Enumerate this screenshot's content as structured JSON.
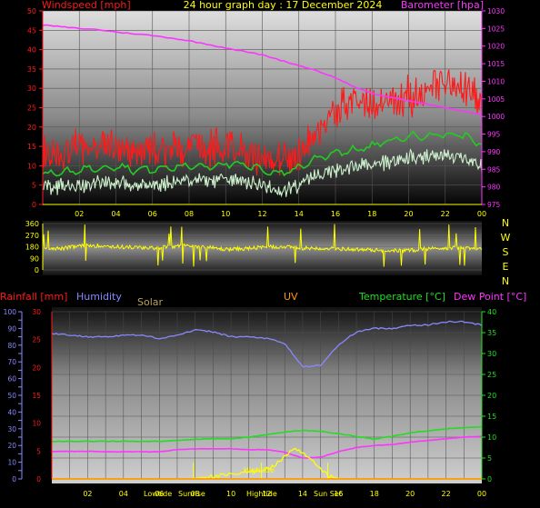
{
  "header": {
    "title": "24 hour graph day : 17 December 2024",
    "wind_label": "Windspeed [mph]",
    "baro_label": "Barometer [hpa]"
  },
  "bottom_legend": {
    "rainfall": "Rainfall [mm]",
    "humidity": "Humidity",
    "solar": "Solar",
    "uv": "UV",
    "temperature": "Temperature [°C]",
    "dewpoint": "Dew Point [°C]"
  },
  "compass": [
    "N",
    "W",
    "S",
    "E",
    "N"
  ],
  "annotations": {
    "lowtide": "Lowtide",
    "sunrise": "Sunrise",
    "hightide_top": "Hightide",
    "hightide_axis": "Hightide",
    "sunset": "Sun Set"
  },
  "colors": {
    "wind": "#ff1a1a",
    "gust_avg": "#22cc22",
    "wind_avg": "#ccf0cc",
    "barometer": "#ff33ff",
    "direction": "#ffff00",
    "humidity": "#8888ff",
    "temperature": "#22dd22",
    "dewpoint": "#ff33ff",
    "solar": "#ffff00",
    "rain": "#ff9900"
  },
  "chart_data": [
    {
      "type": "line",
      "title": "24 hour graph day : 17 December 2024",
      "x_ticks": [
        "02",
        "04",
        "06",
        "08",
        "10",
        "12",
        "14",
        "16",
        "18",
        "20",
        "22",
        "00"
      ],
      "x_range_hours": [
        0,
        24
      ],
      "y_left": {
        "label": "Windspeed [mph]",
        "ticks": [
          0,
          5,
          10,
          15,
          20,
          25,
          30,
          35,
          40,
          45,
          50
        ],
        "range": [
          0,
          50
        ]
      },
      "y_right": {
        "label": "Barometer [hpa]",
        "ticks": [
          975,
          980,
          985,
          990,
          995,
          1000,
          1005,
          1010,
          1015,
          1020,
          1025,
          1030
        ],
        "range": [
          975,
          1030
        ]
      },
      "series": [
        {
          "name": "Windspeed [mph]",
          "axis": "left",
          "x": [
            0,
            1,
            2,
            3,
            4,
            5,
            6,
            7,
            8,
            9,
            10,
            11,
            12,
            13,
            14,
            15,
            16,
            17,
            18,
            19,
            20,
            21,
            22,
            23,
            24
          ],
          "y": [
            14,
            13,
            15,
            16,
            15,
            14,
            13,
            14,
            15,
            14,
            15,
            14,
            12,
            11,
            13,
            19,
            24,
            26,
            25,
            27,
            28,
            29,
            31,
            30,
            27
          ]
        },
        {
          "name": "gust average",
          "axis": "left",
          "x": [
            0,
            1,
            2,
            3,
            4,
            5,
            6,
            7,
            8,
            9,
            10,
            11,
            12,
            13,
            14,
            15,
            16,
            17,
            18,
            19,
            20,
            21,
            22,
            23,
            24
          ],
          "y": [
            8,
            8,
            9,
            9.5,
            10,
            9,
            9,
            9.5,
            10,
            10,
            10.5,
            10,
            9,
            8,
            9.5,
            12,
            13.5,
            14,
            15,
            16.5,
            17.5,
            18,
            18,
            18,
            15.5
          ]
        },
        {
          "name": "wind average",
          "axis": "left",
          "x": [
            0,
            1,
            2,
            3,
            4,
            5,
            6,
            7,
            8,
            9,
            10,
            11,
            12,
            13,
            14,
            15,
            16,
            17,
            18,
            19,
            20,
            21,
            22,
            23,
            24
          ],
          "y": [
            5,
            4.5,
            5,
            5.5,
            6,
            5,
            5,
            5.5,
            6,
            6,
            6.5,
            6,
            5,
            3,
            5,
            8,
            9,
            9.5,
            10.5,
            11,
            12,
            12,
            12.5,
            12,
            10
          ]
        },
        {
          "name": "Barometer [hpa]",
          "axis": "right",
          "x": [
            0,
            1,
            2,
            3,
            4,
            5,
            6,
            7,
            8,
            9,
            10,
            11,
            12,
            13,
            14,
            15,
            16,
            17,
            18,
            19,
            20,
            21,
            22,
            23,
            24
          ],
          "y": [
            1026,
            1025.5,
            1025,
            1024.7,
            1024,
            1023.5,
            1023,
            1022.3,
            1021.5,
            1020.5,
            1019.5,
            1018.5,
            1017.5,
            1016,
            1014.5,
            1013,
            1011,
            1008.5,
            1006.5,
            1005.5,
            1004.5,
            1003.5,
            1002.5,
            1001.5,
            1000.5
          ]
        }
      ]
    },
    {
      "type": "line",
      "x_ticks": [
        "02",
        "04",
        "06",
        "08",
        "10",
        "12",
        "14",
        "16",
        "18",
        "20",
        "22",
        "00"
      ],
      "y_left": {
        "ticks": [
          0,
          90,
          180,
          270,
          360
        ],
        "range": [
          0,
          360
        ]
      },
      "series": [
        {
          "name": "Wind direction",
          "x": [
            0,
            1,
            2,
            3,
            4,
            5,
            6,
            7,
            8,
            9,
            10,
            11,
            12,
            13,
            14,
            15,
            16,
            17,
            18,
            19,
            20,
            21,
            22,
            23,
            24
          ],
          "y": [
            175,
            165,
            185,
            190,
            180,
            175,
            170,
            180,
            190,
            175,
            160,
            165,
            175,
            180,
            170,
            170,
            165,
            160,
            155,
            150,
            150,
            165,
            170,
            175,
            165
          ]
        }
      ]
    },
    {
      "type": "line",
      "x_ticks": [
        "02",
        "04",
        "Lowtide",
        "06",
        "Sunrise",
        "08",
        "10",
        "Hightide",
        "12",
        "14",
        "Sun Set",
        "16",
        "18",
        "20",
        "22",
        "00"
      ],
      "y_humidity": {
        "label": "Humidity",
        "ticks": [
          0,
          10,
          20,
          30,
          40,
          50,
          60,
          70,
          80,
          90,
          100
        ],
        "range": [
          0,
          100
        ]
      },
      "y_rain": {
        "label": "Rainfall [mm]",
        "ticks": [
          0,
          5,
          10,
          15,
          20,
          25,
          30
        ],
        "range": [
          0,
          30
        ]
      },
      "y_temp": {
        "label": "Temperature [°C]",
        "ticks": [
          0,
          5,
          10,
          15,
          20,
          25,
          30,
          35,
          40
        ],
        "range": [
          0,
          40
        ]
      },
      "series": [
        {
          "name": "Humidity",
          "x": [
            0,
            1,
            2,
            3,
            4,
            5,
            6,
            7,
            8,
            9,
            10,
            11,
            12,
            13,
            14,
            15,
            16,
            17,
            18,
            19,
            20,
            21,
            22,
            23,
            24
          ],
          "y": [
            87,
            86,
            85,
            85,
            86,
            86,
            84,
            86,
            89,
            88,
            85,
            85,
            84,
            81,
            67,
            68,
            80,
            88,
            90,
            90,
            92,
            92,
            94,
            94,
            92
          ]
        },
        {
          "name": "Temperature [°C]",
          "x": [
            0,
            1,
            2,
            3,
            4,
            5,
            6,
            7,
            8,
            9,
            10,
            11,
            12,
            13,
            14,
            15,
            16,
            17,
            18,
            19,
            20,
            21,
            22,
            23,
            24
          ],
          "y": [
            9,
            9,
            9,
            9,
            9,
            9,
            9,
            9.2,
            9.5,
            9.6,
            9.6,
            10,
            10.6,
            11.2,
            11.6,
            11.4,
            10.8,
            10.2,
            9.5,
            10.2,
            11,
            11.5,
            12,
            12.3,
            12.5
          ]
        },
        {
          "name": "Dew Point [°C]",
          "x": [
            0,
            1,
            2,
            3,
            4,
            5,
            6,
            7,
            8,
            9,
            10,
            11,
            12,
            13,
            14,
            15,
            16,
            17,
            18,
            19,
            20,
            21,
            22,
            23,
            24
          ],
          "y": [
            6.6,
            6.6,
            6.6,
            6.5,
            6.5,
            6.5,
            6.5,
            7,
            7.2,
            7.2,
            7.2,
            7,
            7,
            6.4,
            5,
            5.2,
            6.5,
            7.5,
            8,
            8.2,
            8.8,
            9.2,
            9.6,
            10,
            10.2
          ]
        },
        {
          "name": "Solar",
          "x": [
            0,
            7.3,
            8,
            9,
            10,
            11,
            11.5,
            12,
            12.5,
            13,
            13.5,
            14,
            14.5,
            15,
            15.5,
            16,
            16.5,
            24
          ],
          "y": [
            0,
            0,
            0.1,
            0.4,
            0.7,
            1.2,
            1.6,
            1.8,
            2.4,
            4.2,
            5.2,
            4.6,
            3.2,
            1.6,
            0.4,
            0.1,
            0,
            0
          ]
        },
        {
          "name": "Rainfall [mm]",
          "x": [
            0,
            24
          ],
          "y": [
            0,
            0
          ]
        }
      ]
    }
  ]
}
